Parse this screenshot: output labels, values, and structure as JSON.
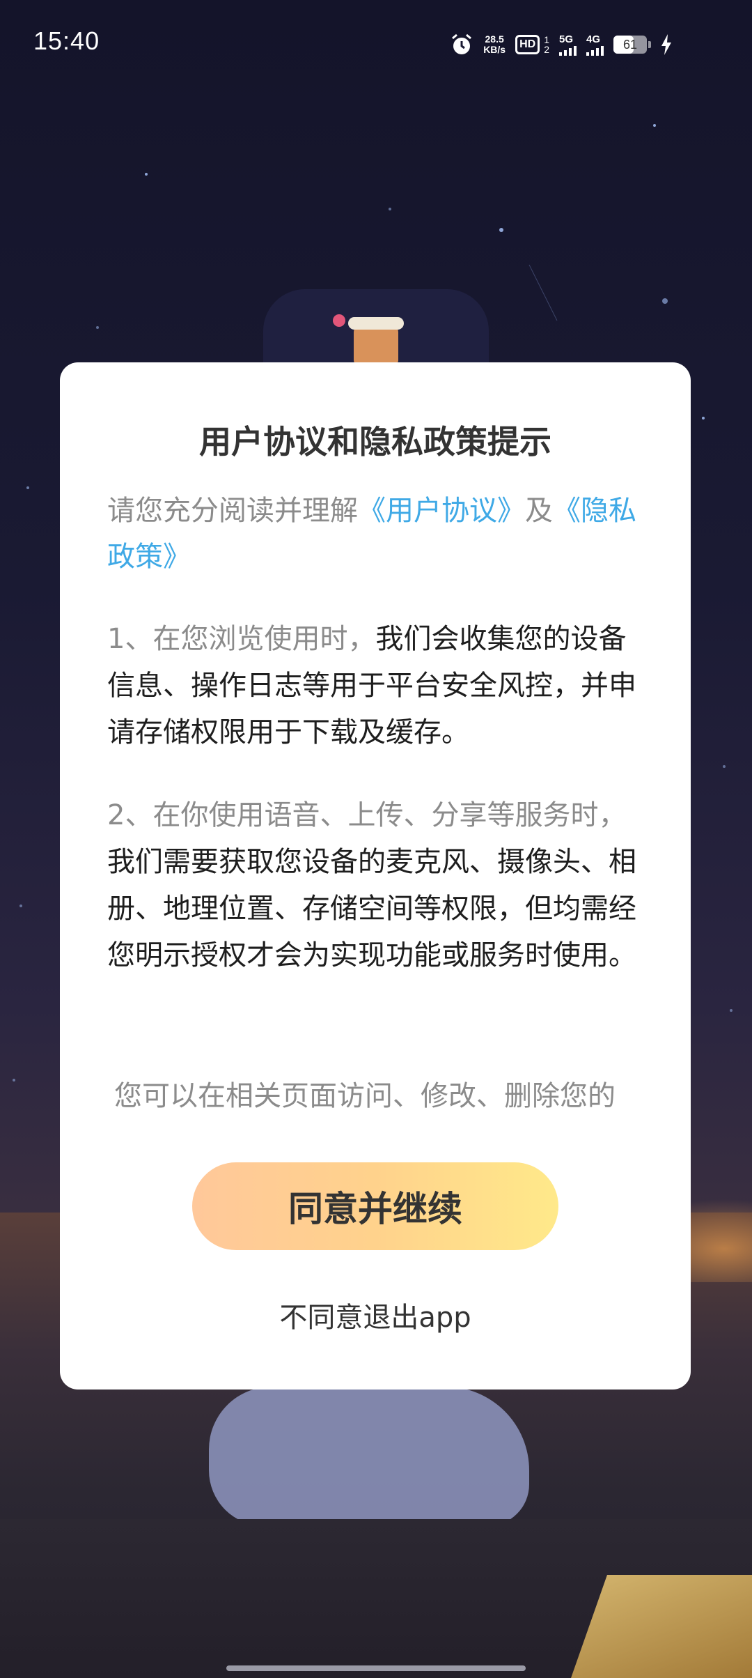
{
  "status_bar": {
    "time": "15:40",
    "net_speed_value": "28.5",
    "net_speed_unit": "KB/s",
    "hd_label": "HD",
    "sim_top": "1",
    "sim_bottom": "2",
    "signal_1_gen": "5G",
    "signal_2_gen": "4G",
    "battery_level": "61",
    "icons": [
      "alarm-icon",
      "hd-icon",
      "signal-icon",
      "battery-icon",
      "charging-icon"
    ]
  },
  "dialog": {
    "title": "用户协议和隐私政策提示",
    "intro_prefix": "请您充分阅读并理解",
    "link_user_agreement": "《用户协议》",
    "intro_conjunction": "及",
    "link_privacy_policy": "《隐私政策》",
    "para1_gray": "1、在您浏览使用时，",
    "para1_dark": "我们会收集您的设备信息、操作日志等用于平台安全风控，并申请存储权限用于下载及缓存。",
    "para2_gray": "2、在你使用语音、上传、分享等服务时，",
    "para2_dark": "我们需要获取您设备的麦克风、摄像头、相册、地理位置、存储空间等权限，但均需经您明示授权才会为实现功能或服务时使用。",
    "para3_partial": "您可以在相关页面访问、修改、删除您的",
    "agree_button": "同意并继续",
    "disagree_link": "不同意退出app"
  },
  "colors": {
    "link": "#3fa9e6",
    "button_gradient_start": "#ffc89a",
    "button_gradient_end": "#ffe98a",
    "text_dark": "#1e1e1e",
    "text_gray": "#8b8b8b"
  }
}
